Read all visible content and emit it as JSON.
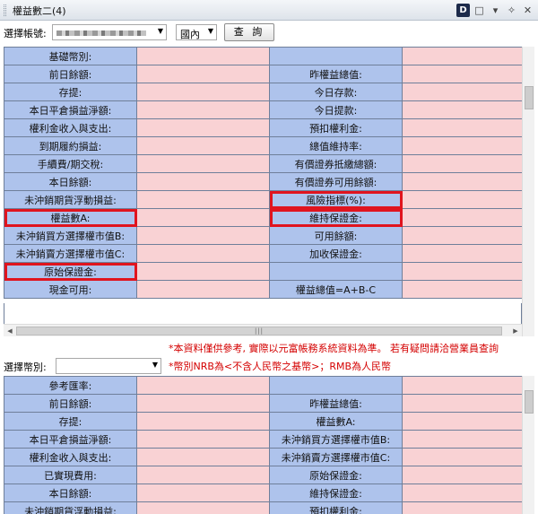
{
  "window": {
    "title": "權益數二(4)"
  },
  "toolbar": {
    "d_icon": "D",
    "page_icon": "□",
    "menu_icon": "▾",
    "pin_icon": "✧",
    "close_icon": "✕"
  },
  "account": {
    "label": "選擇帳號:",
    "market_value": "國內",
    "query_label": "查 詢"
  },
  "table1": {
    "rows": [
      [
        "基礎幣別:",
        "",
        "",
        ""
      ],
      [
        "前日餘額:",
        "",
        "昨權益總值:",
        ""
      ],
      [
        "存提:",
        "",
        "今日存款:",
        ""
      ],
      [
        "本日平倉損益淨額:",
        "",
        "今日提款:",
        ""
      ],
      [
        "權利金收入與支出:",
        "",
        "預扣權利金:",
        ""
      ],
      [
        "到期履約損益:",
        "",
        "總值維持率:",
        ""
      ],
      [
        "手續費/期交稅:",
        "",
        "有價證券抵繳總額:",
        ""
      ],
      [
        "本日餘額:",
        "",
        "有價證券可用餘額:",
        ""
      ],
      [
        "未沖銷期貨浮動損益:",
        "",
        "風險指標(%):",
        ""
      ],
      [
        "權益數A:",
        "",
        "維持保證金:",
        ""
      ],
      [
        "未沖銷買方選擇權市值B:",
        "",
        "可用餘額:",
        ""
      ],
      [
        "未沖銷賣方選擇權市值C:",
        "",
        "加收保證金:",
        ""
      ],
      [
        "原始保證金:",
        "",
        "",
        ""
      ],
      [
        "現金可用:",
        "",
        "權益總值=A+B-C",
        ""
      ]
    ]
  },
  "notices": {
    "line1": "*本資料僅供參考, 實際以元富帳務系統資料為準。 若有疑問請洽營業員查詢",
    "line2": "*幣別NRB為<不含人民幣之基幣>；RMB為人民幣"
  },
  "currency": {
    "label": "選擇幣別:",
    "value": ""
  },
  "table2": {
    "rows": [
      [
        "參考匯率:",
        "",
        "",
        ""
      ],
      [
        "前日餘額:",
        "",
        "昨權益總值:",
        ""
      ],
      [
        "存提:",
        "",
        "權益數A:",
        ""
      ],
      [
        "本日平倉損益淨額:",
        "",
        "未沖銷買方選擇權市值B:",
        ""
      ],
      [
        "權利金收入與支出:",
        "",
        "未沖銷賣方選擇權市值C:",
        ""
      ],
      [
        "已實現費用:",
        "",
        "原始保證金:",
        ""
      ],
      [
        "本日餘額:",
        "",
        "維持保證金:",
        ""
      ],
      [
        "未沖銷期貨浮動損益:",
        "",
        "預扣權利金:",
        ""
      ]
    ]
  }
}
